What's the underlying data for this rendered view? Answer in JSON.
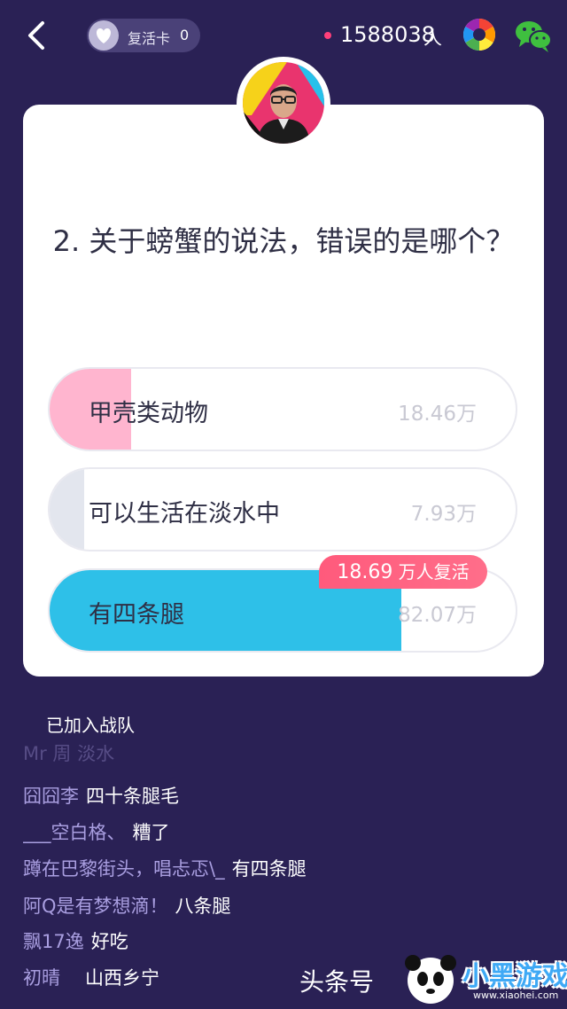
{
  "colors": {
    "background": "#2a2155",
    "card": "#ffffff",
    "pink_fill": "#ffb5cf",
    "grey_fill": "#e3e6ee",
    "blue_fill": "#2ec0e8",
    "revive_tag": "#ff5f80",
    "username": "#a99ee0"
  },
  "header": {
    "back_icon": "chevron-left-icon",
    "revive_card_label": "复活卡",
    "revive_card_count": "0",
    "online_count": "1588038",
    "online_unit": "人",
    "share_icons": [
      "color-wheel-icon",
      "wechat-icon"
    ]
  },
  "question": {
    "text": "2. 关于螃蟹的说法，错误的是哪个？"
  },
  "options": [
    {
      "label": "甲壳类动物",
      "count": "18.46万",
      "fill_fraction": 0.175,
      "fill_color": "pink"
    },
    {
      "label": "可以生活在淡水中",
      "count": "7.93万",
      "fill_fraction": 0.075,
      "fill_color": "grey"
    },
    {
      "label": "有四条腿",
      "count": "82.07万",
      "fill_fraction": 0.755,
      "fill_color": "blue",
      "correct": true
    }
  ],
  "revive_tag": {
    "number": "18.69",
    "suffix": "万人复活"
  },
  "team": {
    "label": "已加入战队"
  },
  "chat": [
    {
      "user": "Mr 周 淡水",
      "message": ""
    },
    {
      "user": "囧囧李",
      "message": "四十条腿毛"
    },
    {
      "user": "___空白格、",
      "message": "糟了"
    },
    {
      "user": "蹲在巴黎街头，唱忐忑\\_",
      "message": "有四条腿"
    },
    {
      "user": "阿Q是有梦想滴！",
      "message": "八条腿"
    },
    {
      "user": "飘17逸",
      "message": "好吃"
    },
    {
      "user": "初晴",
      "message": "山西乡宁"
    }
  ],
  "watermark": {
    "text": "头条号",
    "logo_text": "小黑游戏",
    "logo_url": "www.xiaohei.com"
  }
}
